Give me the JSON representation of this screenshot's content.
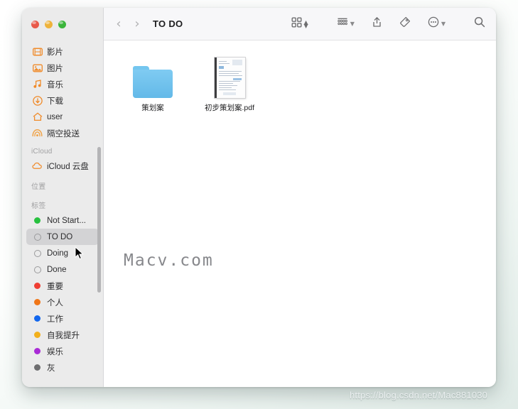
{
  "window": {
    "title": "TO DO",
    "traffic_lights": [
      {
        "name": "close",
        "color": "#e8594a"
      },
      {
        "name": "minimize",
        "color": "#eeb33b"
      },
      {
        "name": "maximize",
        "color": "#3bb53b"
      }
    ]
  },
  "toolbar": {
    "back_glyph": "‹",
    "forward_glyph": "›",
    "buttons": [
      {
        "name": "view-grid",
        "icon": "grid-view-icon",
        "has_stepper": true
      },
      {
        "name": "group-by",
        "icon": "group-list-icon",
        "has_chevron": true
      },
      {
        "name": "share",
        "icon": "share-icon"
      },
      {
        "name": "tag",
        "icon": "tag-icon"
      },
      {
        "name": "more-actions",
        "icon": "ellipsis-circle-icon",
        "has_chevron": true
      },
      {
        "name": "search",
        "icon": "search-icon"
      }
    ]
  },
  "sidebar": {
    "favorites": [
      {
        "label": "影片",
        "icon": "movies-icon",
        "color": "#f08a28"
      },
      {
        "label": "图片",
        "icon": "pictures-icon",
        "color": "#f08a28"
      },
      {
        "label": "音乐",
        "icon": "music-icon",
        "color": "#f08a28"
      },
      {
        "label": "下载",
        "icon": "downloads-icon",
        "color": "#f08a28"
      },
      {
        "label": "user",
        "icon": "home-icon",
        "color": "#f08a28"
      },
      {
        "label": "隔空投送",
        "icon": "airdrop-icon",
        "color": "#f0a44a"
      }
    ],
    "sections": {
      "icloud": "iCloud",
      "locations": "位置",
      "tags": "标签"
    },
    "icloud_items": [
      {
        "label": "iCloud 云盘",
        "icon": "icloud-icon",
        "color": "#f08a28"
      }
    ],
    "tags": [
      {
        "label": "Not Start...",
        "color": "#28c13f",
        "hollow": false,
        "selected": false
      },
      {
        "label": "TO DO",
        "color": "#ffffff",
        "hollow": true,
        "selected": true
      },
      {
        "label": "Doing",
        "color": "#ffffff",
        "hollow": true,
        "selected": false
      },
      {
        "label": "Done",
        "color": "#ffffff",
        "hollow": true,
        "selected": false
      },
      {
        "label": "重要",
        "color": "#ef3e33",
        "hollow": false,
        "selected": false
      },
      {
        "label": "个人",
        "color": "#f07618",
        "hollow": false,
        "selected": false
      },
      {
        "label": "工作",
        "color": "#1367ee",
        "hollow": false,
        "selected": false
      },
      {
        "label": "自我提升",
        "color": "#f2b01c",
        "hollow": false,
        "selected": false
      },
      {
        "label": "娱乐",
        "color": "#a92bd6",
        "hollow": false,
        "selected": false
      },
      {
        "label": "灰",
        "color": "#6e6e70",
        "hollow": false,
        "selected": false
      }
    ]
  },
  "files": [
    {
      "name": "策划案",
      "type": "folder"
    },
    {
      "name": "初步策划案.pdf",
      "type": "pdf"
    }
  ],
  "watermarks": {
    "center": "Macv.com",
    "bottom_url": "https://blog.csdn.net/Mac881030"
  }
}
